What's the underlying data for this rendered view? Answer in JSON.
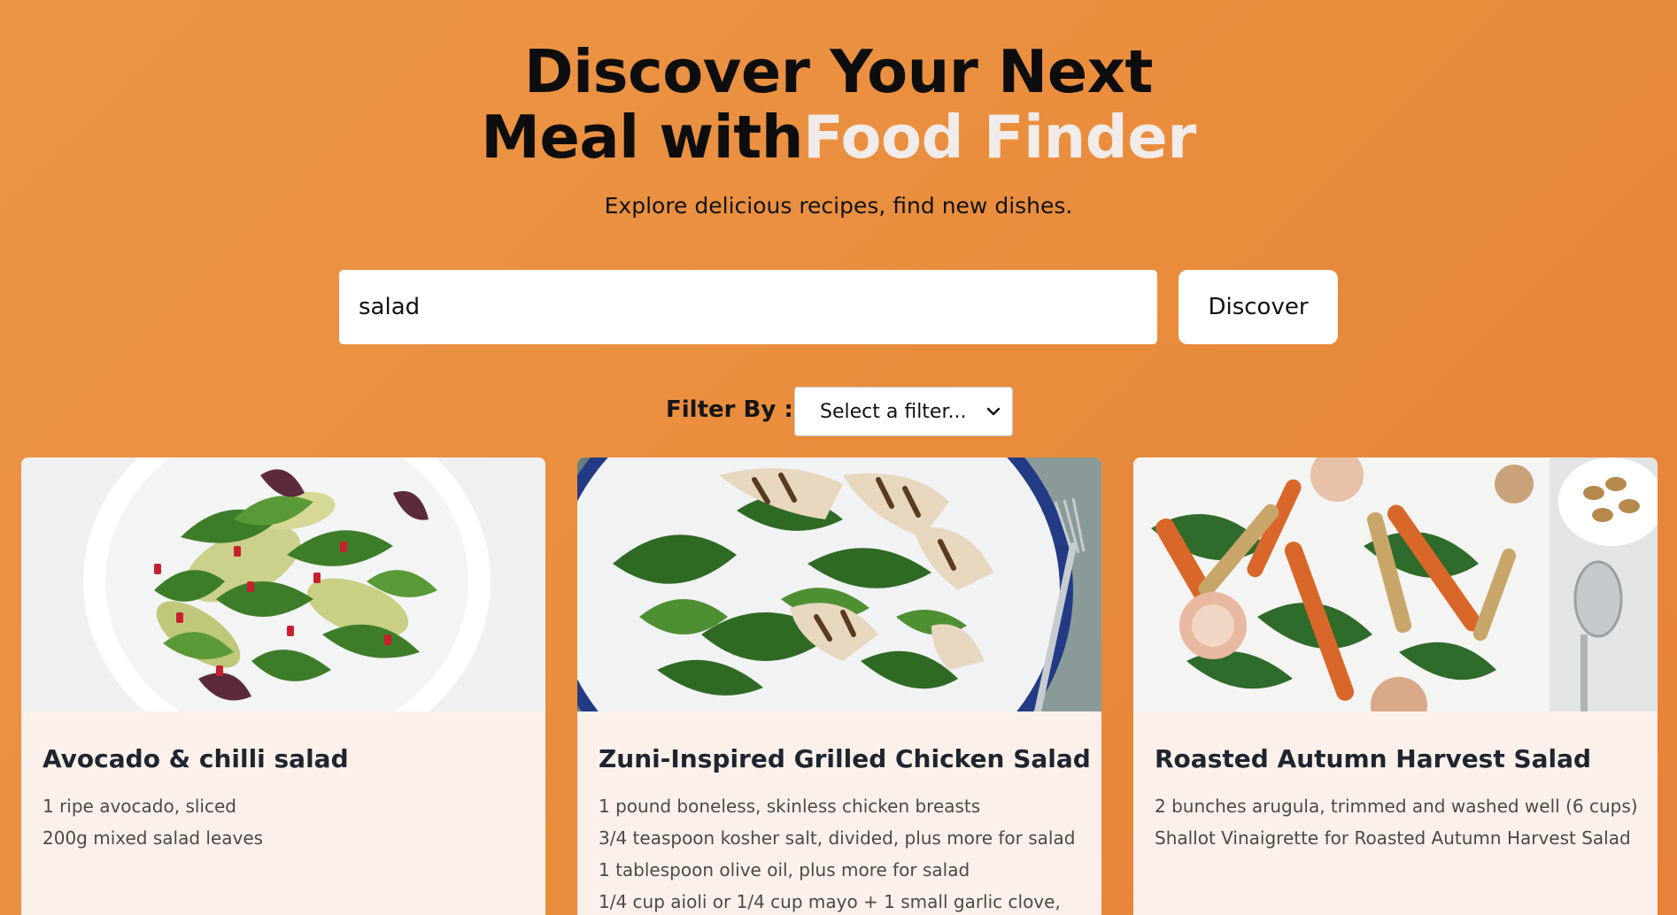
{
  "hero": {
    "title_line1": "Discover Your Next",
    "title_line2_prefix": "Meal with",
    "title_accent": "Food Finder",
    "subtitle": "Explore delicious recipes, find new dishes."
  },
  "search": {
    "value": "salad",
    "button_label": "Discover"
  },
  "filter": {
    "label": "Filter By :",
    "selected": "Select a filter..."
  },
  "recipes": [
    {
      "title": "Avocado & chilli salad",
      "ingredients": [
        "1 ripe avocado, sliced",
        "200g mixed salad leaves"
      ]
    },
    {
      "title": "Zuni-Inspired Grilled Chicken Salad",
      "ingredients": [
        "1 pound boneless, skinless chicken breasts",
        "3/4 teaspoon kosher salt, divided, plus more for salad",
        "1 tablespoon olive oil, plus more for salad",
        "1/4 cup aioli or 1/4 cup mayo + 1 small garlic clove,"
      ]
    },
    {
      "title": "Roasted Autumn Harvest Salad",
      "ingredients": [
        "2 bunches arugula, trimmed and washed well (6 cups)",
        "Shallot Vinaigrette for Roasted Autumn Harvest Salad"
      ]
    }
  ],
  "colors": {
    "background": "#e98c3c",
    "accent_text": "#f1ece9",
    "card_background": "#fcf1ea"
  }
}
